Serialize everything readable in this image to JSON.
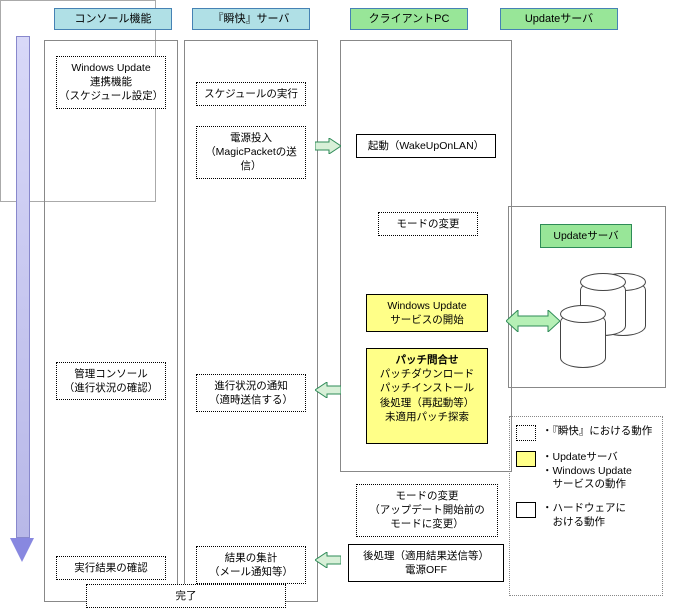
{
  "headers": {
    "h1": "コンソール機能",
    "h2": "『瞬快』サーバ",
    "h3": "クライアントPC",
    "h4": "Updateサーバ"
  },
  "col1": {
    "n1": "Windows Update\n連携機能\n（スケジュール設定）",
    "n2": "管理コンソール\n（進行状況の確認）",
    "n3": "実行結果の確認"
  },
  "col2": {
    "n1": "スケジュールの実行",
    "n2": "電源投入\n（MagicPacketの送信）",
    "n3": "進行状況の通知\n（適時送信する）",
    "n4": "結果の集計\n（メール通知等）",
    "n5": "完了"
  },
  "col3": {
    "n1": "起動（WakeUpOnLAN）",
    "n2": "モードの変更",
    "n3": "Windows Update\nサービスの開始",
    "n4_title": "パッチ問合せ",
    "n4_body": "パッチダウンロード\nパッチインストール\n後処理（再起動等）\n未適用パッチ探索",
    "n5": "モードの変更\n（アップデート開始前の\nモードに変更）",
    "n6": "後処理（適用結果送信等）\n電源OFF"
  },
  "update_box": {
    "title": "Updateサーバ"
  },
  "legend": {
    "r1": "・『瞬快』における動作",
    "r2": "・Updateサーバ\n・Windows Update\n　サービスの動作",
    "r3": "・ハードウェアに\n　おける動作"
  }
}
